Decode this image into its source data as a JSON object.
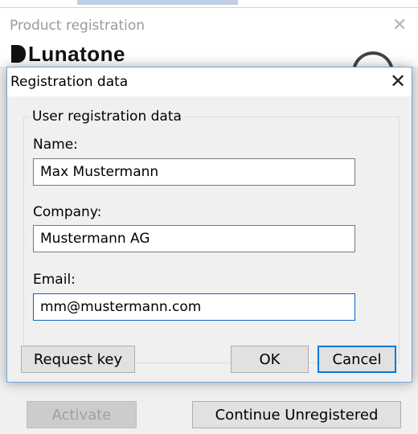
{
  "background_window": {
    "title": "Product registration",
    "close_glyph": "✕",
    "logo_text": "Lunatone",
    "buttons": {
      "activate": "Activate",
      "continue_unregistered": "Continue Unregistered"
    }
  },
  "dialog": {
    "title": "Registration data",
    "close_glyph": "✕",
    "group_title": "User registration data",
    "fields": {
      "name": {
        "label": "Name:",
        "value": "Max Mustermann"
      },
      "company": {
        "label": "Company:",
        "value": "Mustermann AG"
      },
      "email": {
        "label": "Email:",
        "value": "mm@mustermann.com"
      }
    },
    "buttons": {
      "request_key": "Request key",
      "ok": "OK",
      "cancel": "Cancel"
    }
  },
  "colors": {
    "accent": "#0078d7",
    "dialog_bg": "#f0f0f0",
    "titlebar_bg": "#ffffff"
  }
}
